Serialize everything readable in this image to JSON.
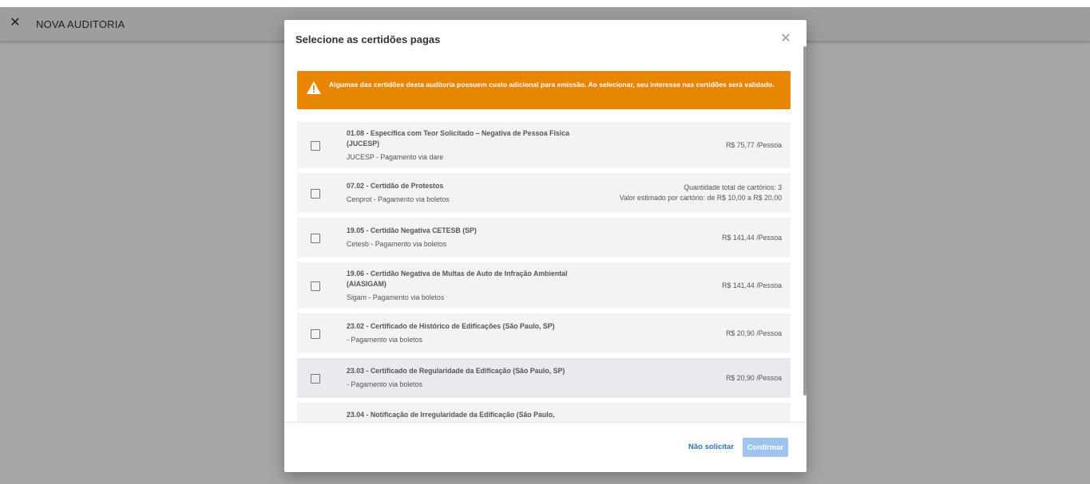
{
  "appbar": {
    "title": "NOVA AUDITORIA",
    "close_icon": "close-icon"
  },
  "modal": {
    "title": "Selecione as certidões pagas",
    "alert": "Algumas das certidões desta auditoria possuem custo adicional para emissão. Ao selecionar, seu interesse nas certidões será validado.",
    "items": [
      {
        "name": "01.08 - Específica com Teor Solicitado – Negativa de Pessoa Física (JUCESP)",
        "sub": "JUCESP - Pagamento via dare",
        "price": "R$ 75,77 /Pessoa",
        "price2": ""
      },
      {
        "name": "07.02 - Certidão de Protestos",
        "sub": "Cenprot - Pagamento via boletos",
        "price": "Quantidade total de cartórios: 3",
        "price2": "Valor estimado por cartório: de R$ 10,00 a R$ 20,00"
      },
      {
        "name": "19.05 - Certidão Negativa CETESB (SP)",
        "sub": "Cetesb - Pagamento via boletos",
        "price": "R$ 141,44 /Pessoa",
        "price2": ""
      },
      {
        "name": "19.06 - Certidão Negativa de Multas de Auto de Infração Ambiental (AIASIGAM)",
        "sub": "Sigam - Pagamento via boletos",
        "price": "R$ 141,44 /Pessoa",
        "price2": ""
      },
      {
        "name": "23.02 - Certificado de Histórico de Edificações (São Paulo, SP)",
        "sub": "- Pagamento via boletos",
        "price": "R$ 20,90 /Pessoa",
        "price2": ""
      },
      {
        "name": "23.03 - Certificado de Regularidade da Edificação (São Paulo, SP)",
        "sub": "- Pagamento via boletos",
        "price": "R$ 20,90 /Pessoa",
        "price2": ""
      },
      {
        "name": "23.04 - Notificação de Irregularidade da Edificação (São Paulo,",
        "sub": "",
        "price": "",
        "price2": ""
      }
    ],
    "footer": {
      "decline_label": "Não solicitar",
      "confirm_label": "Confirmar"
    }
  }
}
